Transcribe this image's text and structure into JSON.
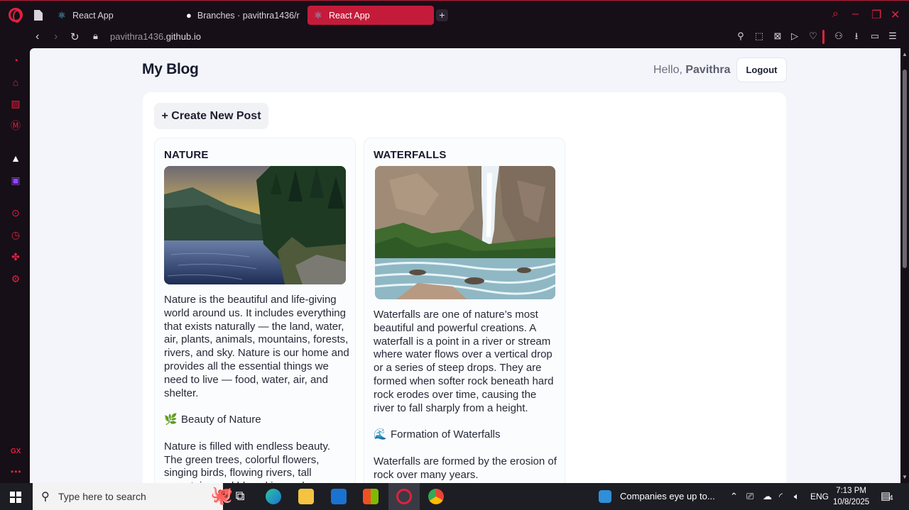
{
  "browser": {
    "tabs": [
      {
        "label": "React App",
        "icon": "react-icon",
        "active": false
      },
      {
        "label": "Branches · pavithra1436/r",
        "icon": "github-icon",
        "active": false
      },
      {
        "label": "React App",
        "icon": "react-icon",
        "active": true
      }
    ],
    "new_tab": "+",
    "url_host": "pavithra1436",
    "url_rest": ".github.io",
    "accent": "#e0213f"
  },
  "page": {
    "site_title": "My Blog",
    "greeting": "Hello,",
    "user_name": "Pavithra",
    "logout_label": "Logout",
    "create_label": "+ Create New Post"
  },
  "posts": [
    {
      "title": "NATURE",
      "paragraph_1": "Nature is the beautiful and life-giving world around us. It includes everything that exists naturally — the land, water, air, plants, animals, mountains, forests, rivers, and sky. Nature is our home and provides all the essential things we need to live — food, water, air, and shelter.",
      "heading_emoji": "🌿",
      "heading": "Beauty of Nature",
      "paragraph_2": "Nature is filled with endless beauty. The green trees, colorful flowers, singing birds, flowing rivers, tall mountains and blue skies make"
    },
    {
      "title": "WATERFALLS",
      "paragraph_1": "Waterfalls are one of nature’s most beautiful and powerful creations. A waterfall is a point in a river or stream where water flows over a vertical drop or a series of steep drops. They are formed when softer rock beneath hard rock erodes over time, causing the river to fall sharply from a height.",
      "heading_emoji": "🌊",
      "heading": "Formation of Waterfalls",
      "paragraph_2": "Waterfalls are formed by the erosion of rock over many years."
    }
  ],
  "taskbar": {
    "search_placeholder": "Type here to search",
    "news": "Companies eye up to...",
    "language": "ENG",
    "time": "7:13 PM",
    "date": "10/8/2025",
    "notification_count": "4"
  }
}
